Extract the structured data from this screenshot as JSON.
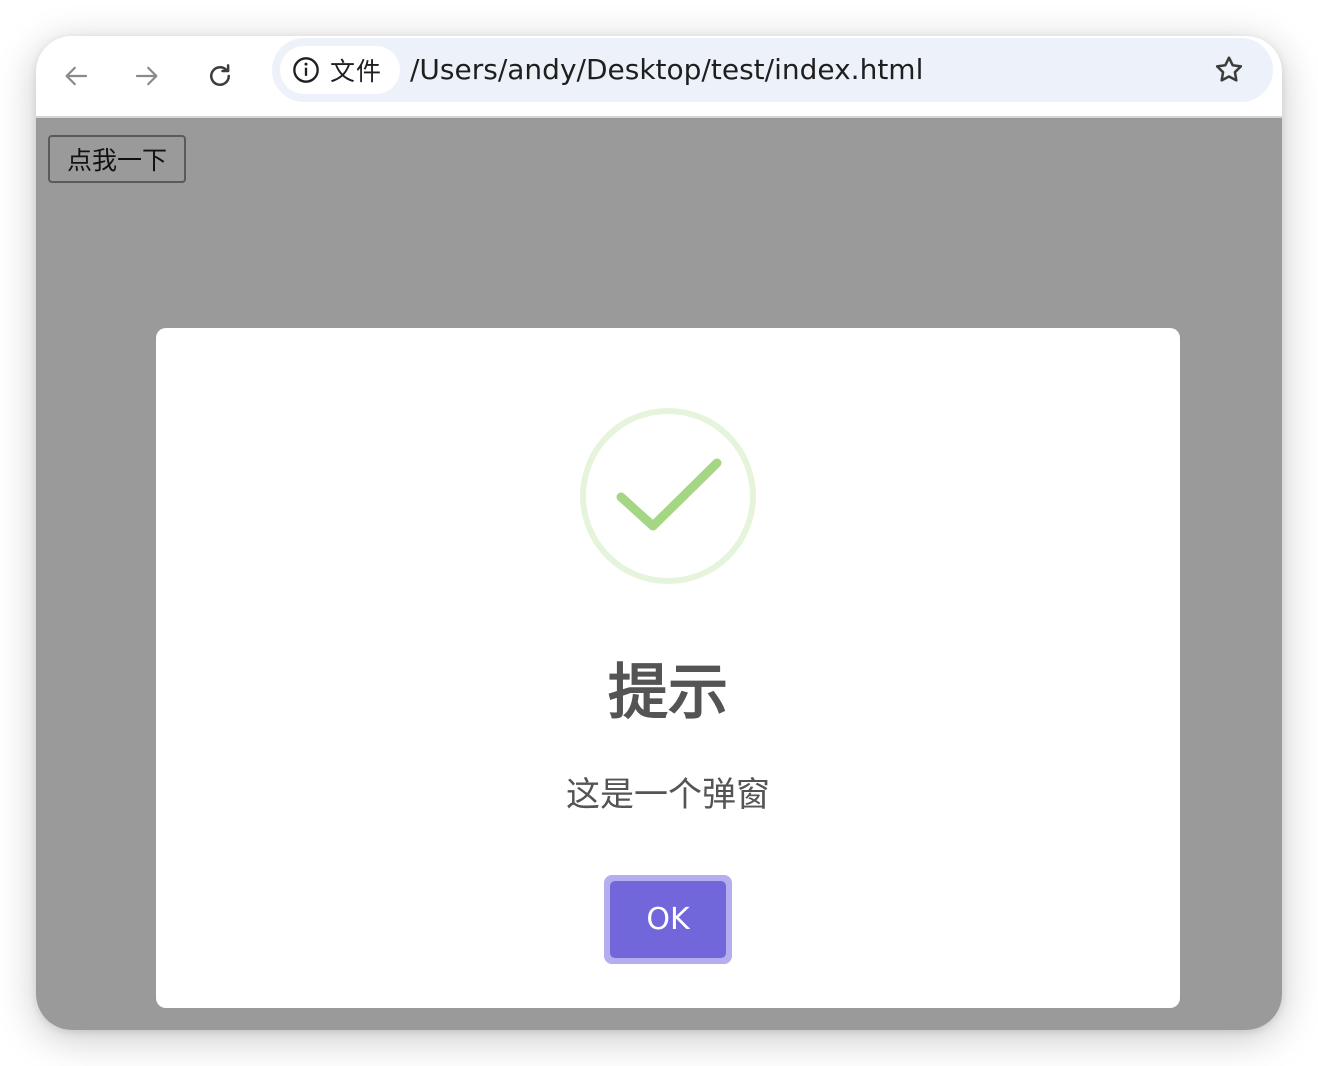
{
  "browser": {
    "site_info_label": "文件",
    "url": "/Users/andy/Desktop/test/index.html",
    "icons": {
      "back": "arrow-left-icon",
      "forward": "arrow-right-icon",
      "reload": "reload-icon",
      "site_info": "info-circle-icon",
      "bookmark": "star-icon"
    }
  },
  "page": {
    "button_label": "点我一下"
  },
  "dialog": {
    "icon": "success-check-icon",
    "title": "提示",
    "text": "这是一个弹窗",
    "confirm_label": "OK"
  },
  "colors": {
    "overlay": "#9a9a9a",
    "success_icon_ring": "#e6f4dc",
    "success_icon_check": "#a5d684",
    "ok_button": "#7267da",
    "ok_button_focus_ring": "#b4aeef"
  }
}
